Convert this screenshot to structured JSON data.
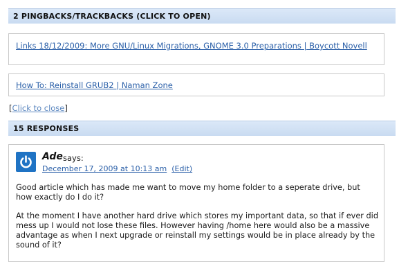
{
  "pingbacks": {
    "header": "2 PINGBACKS/TRACKBACKS (CLICK TO OPEN)",
    "items": [
      "Links 18/12/2009: More GNU/Linux Migrations, GNOME 3.0 Preparations | Boycott Novell",
      "How To: Reinstall GRUB2 | Naman Zone"
    ],
    "close_prefix": "[",
    "close_label": "Click to close",
    "close_suffix": "]"
  },
  "responses": {
    "header": "15 RESPONSES"
  },
  "comment": {
    "author": "Ade",
    "says": "says:",
    "date": "December 17, 2009 at 10:13 am",
    "edit": "(Edit)",
    "paragraphs": [
      "Good article which has made me want to move my home folder to a seperate drive, but how exactly do I do it?",
      "At the moment I have another hard drive which stores my important data, so that if ever did mess up I would not lose these files. However having /home here would also be a massive advantage as when I next upgrade or reinstall my settings would be in place already by the sound of it?"
    ],
    "avatar_icon": "power-icon"
  },
  "colors": {
    "header_bg": "#c9dbf1",
    "link": "#2a5fa8",
    "avatar": "#1f73c4"
  }
}
